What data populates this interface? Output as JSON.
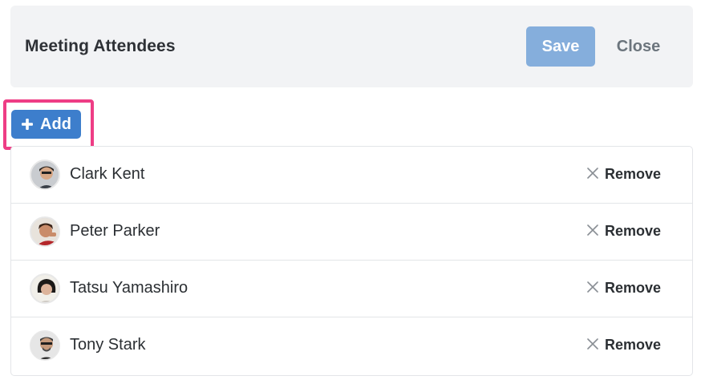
{
  "header": {
    "title": "Meeting Attendees",
    "save_label": "Save",
    "close_label": "Close"
  },
  "add_button": {
    "label": "Add",
    "icon": "plus-icon"
  },
  "attendees": [
    {
      "name": "Clark Kent",
      "remove_label": "Remove",
      "icon": "close-x-icon"
    },
    {
      "name": "Peter Parker",
      "remove_label": "Remove",
      "icon": "close-x-icon"
    },
    {
      "name": "Tatsu Yamashiro",
      "remove_label": "Remove",
      "icon": "close-x-icon"
    },
    {
      "name": "Tony Stark",
      "remove_label": "Remove",
      "icon": "close-x-icon"
    }
  ],
  "colors": {
    "primary": "#3d7ecc",
    "save_disabled": "#85aedc",
    "highlight": "#ee3d85",
    "header_bg": "#f2f3f5"
  }
}
